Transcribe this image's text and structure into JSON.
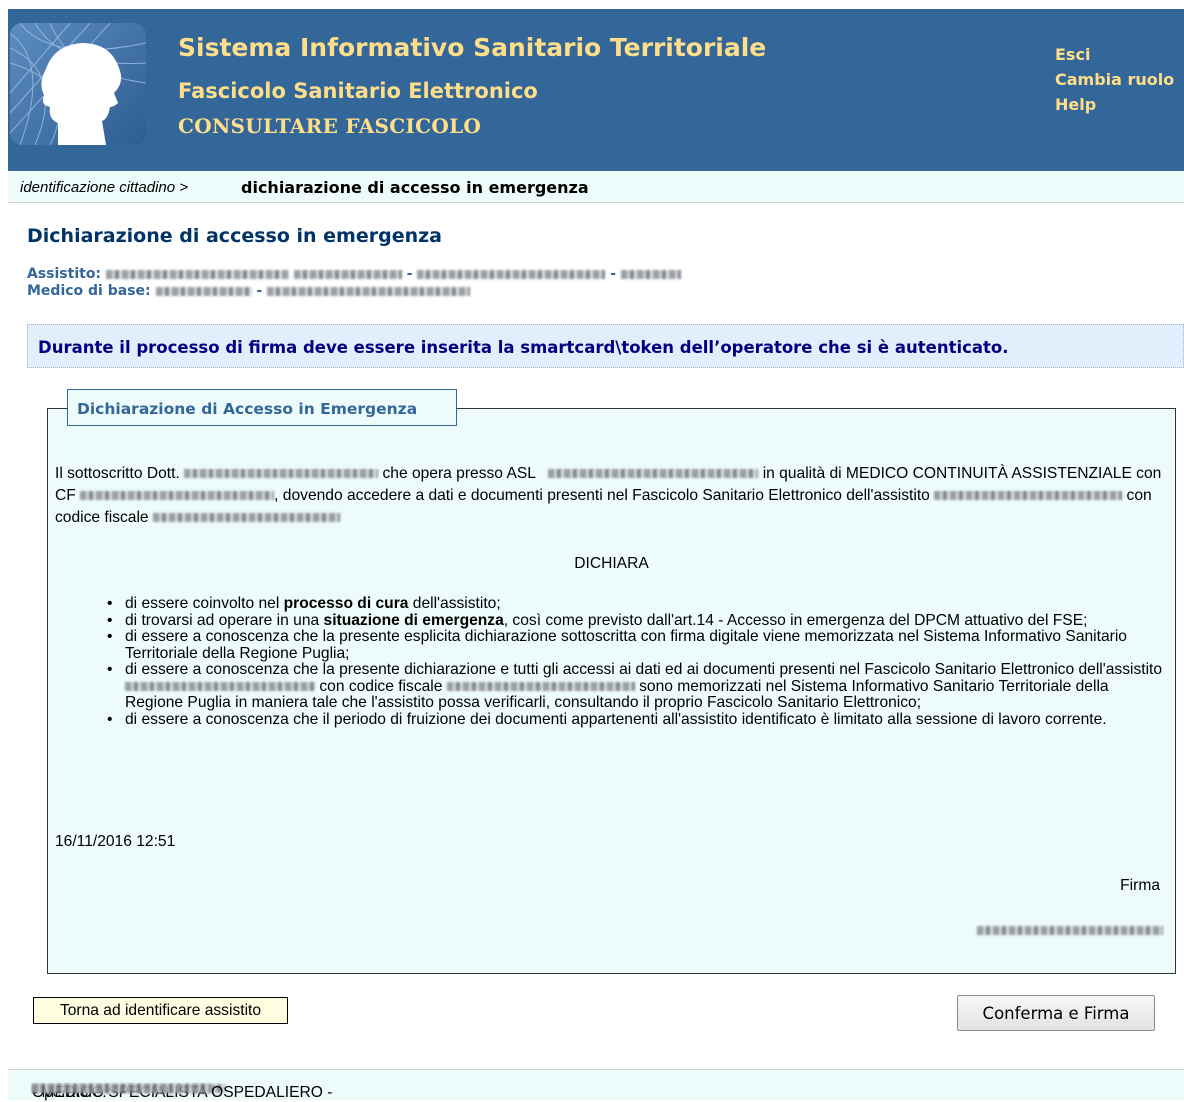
{
  "header": {
    "title": "Sistema Informativo Sanitario Territoriale",
    "subtitle": "Fascicolo Sanitario Elettronico",
    "module": "CONSULTARE FASCICOLO",
    "links": [
      "Esci",
      "Cambia ruolo",
      "Help"
    ],
    "logo_icon": "patient-profile-logo-icon",
    "bg_color": "#336699",
    "text_color": "#ffde8a"
  },
  "breadcrumb": {
    "previous": "identificazione cittadino",
    "separator": " > ",
    "current": "dichiarazione di accesso in emergenza"
  },
  "page": {
    "title": "Dichiarazione di accesso in emergenza",
    "assistito_label": "Assistito:",
    "medico_label": "Medico di base:",
    "separator": "-"
  },
  "notice": "Durante il processo di firma deve essere inserita la smartcard\\token dell’operatore che si è autenticato.",
  "declaration": {
    "legend": "Dichiarazione di Accesso in Emergenza",
    "p1": "Il sottoscritto Dott.",
    "p2": "che opera presso ASL",
    "p3": "in qualità di MEDICO CONTINUITÀ ASSISTENZIALE con CF",
    "p4": ", dovendo accedere a dati e documenti presenti nel Fascicolo Sanitario Elettronico dell'assistito",
    "p5": "con codice fiscale",
    "heading": "DICHIARA",
    "items": [
      {
        "pre": "di essere coinvolto nel ",
        "bold": "processo di cura",
        "post": " dell'assistito;"
      },
      {
        "pre": "di trovarsi ad operare in una ",
        "bold": "situazione di emergenza",
        "post": ", così come previsto dall'art.14 - Accesso in emergenza del DPCM attuativo del FSE;"
      },
      {
        "pre": "di essere a conoscenza che la presente esplicita dichiarazione sottoscritta con firma digitale viene memorizzata nel Sistema Informativo Sanitario Territoriale della Regione Puglia;",
        "bold": "",
        "post": ""
      }
    ],
    "item4_pre": "di essere a conoscenza che la presente dichiarazione e tutti gli accessi ai dati ed ai documenti presenti nel Fascicolo Sanitario Elettronico dell'assistito",
    "item4_mid": "con codice fiscale",
    "item4_post": "sono memorizzati nel Sistema Informativo Sanitario Territoriale della Regione Puglia in maniera tale che l'assistito possa verificarli, consultando il proprio Fascicolo Sanitario Elettronico;",
    "item5": "di essere a conoscenza che il periodo di fruizione dei documenti appartenenti all'assistito identificato è limitato alla sessione di lavoro corrente.",
    "date": "16/11/2016 12:51",
    "signature_label": "Firma"
  },
  "buttons": {
    "back": "Torna ad identificare assistito",
    "confirm": "Conferma e Firma"
  },
  "footer": {
    "label": "Operatore:",
    "role": "- MEDICO SPECIALISTA OSPEDALIERO -"
  }
}
